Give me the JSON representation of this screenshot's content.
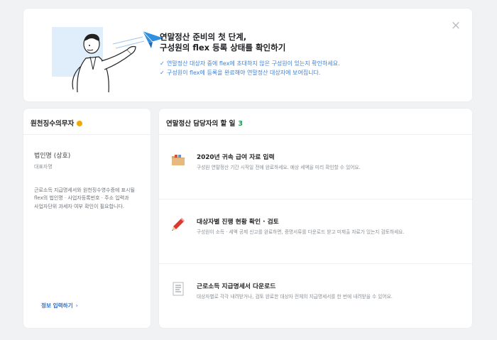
{
  "banner": {
    "title_line1": "연말정산 준비의 첫 단계,",
    "title_line2": "구성원의 flex 등록 상태를 확인하기",
    "checks": [
      "연말정산 대상자 중에 flex에 초대하지 않은 구성원이 있는지 확인하세요.",
      "구성원이 flex에 등록을 완료해야 연말정산 대상자에 보여집니다."
    ],
    "check_mark": "✓",
    "close_icon": "×"
  },
  "withholding": {
    "title": "원천징수의무자",
    "company_name": "법인명 (상호)",
    "representative": "대표자명",
    "description_lines": [
      "근로소득 지급명세서와 원천징수영수증에 표시될",
      "flex의 법인명 · 사업자등록번호 · 주소 입력과",
      "사업자단위 과세자 여부 확인이 필요합니다."
    ],
    "link_label": "정보 입력하기",
    "link_chevron": "›"
  },
  "tasks": {
    "title": "연말정산 담당자의 할 일",
    "count": "3",
    "items": [
      {
        "icon": "folder-icon",
        "title": "2020년 귀속 급여 자료 입력",
        "desc": "구성원 연말정산 기간 시작일 전에 완료하세요. 예상 세액을 미리 확인할 수 있어요."
      },
      {
        "icon": "pencil-icon",
        "title": "대상자별 진행 현황 확인 · 검토",
        "desc": "구성원이 소득 · 세액 공제 신고를 완료하면, 증명서류를 다운로드 받고 미제출 자료가 있는지 검토하세요."
      },
      {
        "icon": "document-icon",
        "title": "근로소득 지급명세서 다운로드",
        "desc": "대상자별로 각각 내려받거나, 검토 완료한 대상자 전체의 지급명세서를 한 번에 내려받을 수 있어요."
      }
    ]
  },
  "colors": {
    "background": "#f1f2f4",
    "check_text": "#3c7fd6",
    "link": "#2f6fc9",
    "count": "#1a9d52",
    "warning_dot": "#f3a800"
  }
}
